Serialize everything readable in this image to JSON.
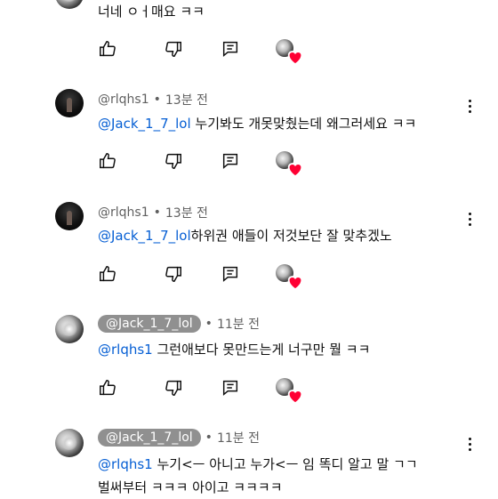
{
  "top": {
    "text": "너네 ㅇㅓ매요 ㅋㅋ"
  },
  "comments": [
    {
      "author": "@rlqhs1",
      "time": "13분 전",
      "mention": "@Jack_1_7_lol",
      "body": " 누기봐도 개못맞췄는데 왜그러세요 ㅋㅋ"
    },
    {
      "author": "@rlqhs1",
      "time": "13분 전",
      "mention": "@Jack_1_7_lol",
      "body": "하위권 애들이 저것보단 잘 맞추겠노"
    },
    {
      "author": "@Jack_1_7_lol",
      "time": "11분 전",
      "mention": "@rlqhs1",
      "body": " 그런애보다 못만드는게 너구만 뭘 ㅋㅋ"
    },
    {
      "author": "@Jack_1_7_lol",
      "time": "11분 전",
      "mention": "@rlqhs1",
      "body": " 누기<ㅡ 아니고 누가<ㅡ 임 똑디 알고 말 ㄱㄱ",
      "body2": "벌써부터 ㅋㅋㅋ 아이고 ㅋㅋㅋㅋ"
    }
  ],
  "icons": {
    "like": "thumbs-up-icon",
    "dislike": "thumbs-down-icon",
    "reply": "reply-icon",
    "creator_heart": "creator-heart-icon",
    "menu": "more-vert-icon"
  },
  "colors": {
    "mention": "#065fd4",
    "meta": "#606060",
    "chip_bg": "#909090",
    "heart": "#ff0033"
  }
}
